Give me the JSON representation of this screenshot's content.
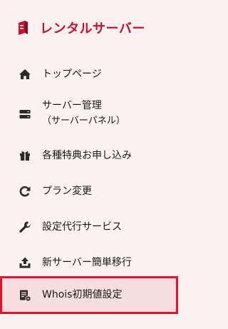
{
  "brand": {
    "title": "レンタルサーバー",
    "color": "#c8102e",
    "icon": "rental-server-logo-icon"
  },
  "nav": {
    "items": [
      {
        "label": "トップページ",
        "icon": "home-icon"
      },
      {
        "label": "サーバー管理",
        "sublabel": "（サーバーパネル）",
        "icon": "server-icon"
      },
      {
        "label": "各種特典お申し込み",
        "icon": "gift-icon"
      },
      {
        "label": "プラン変更",
        "icon": "refresh-icon"
      },
      {
        "label": "設定代行サービス",
        "icon": "wrench-icon"
      },
      {
        "label": "新サーバー簡単移行",
        "icon": "upload-icon"
      },
      {
        "label": "Whois初期値設定",
        "icon": "document-settings-icon",
        "active": true
      }
    ]
  },
  "colors": {
    "background": "#fbf1f1",
    "active_background": "#f6dede",
    "active_border": "#e8112d",
    "text": "#1a1a1a"
  }
}
